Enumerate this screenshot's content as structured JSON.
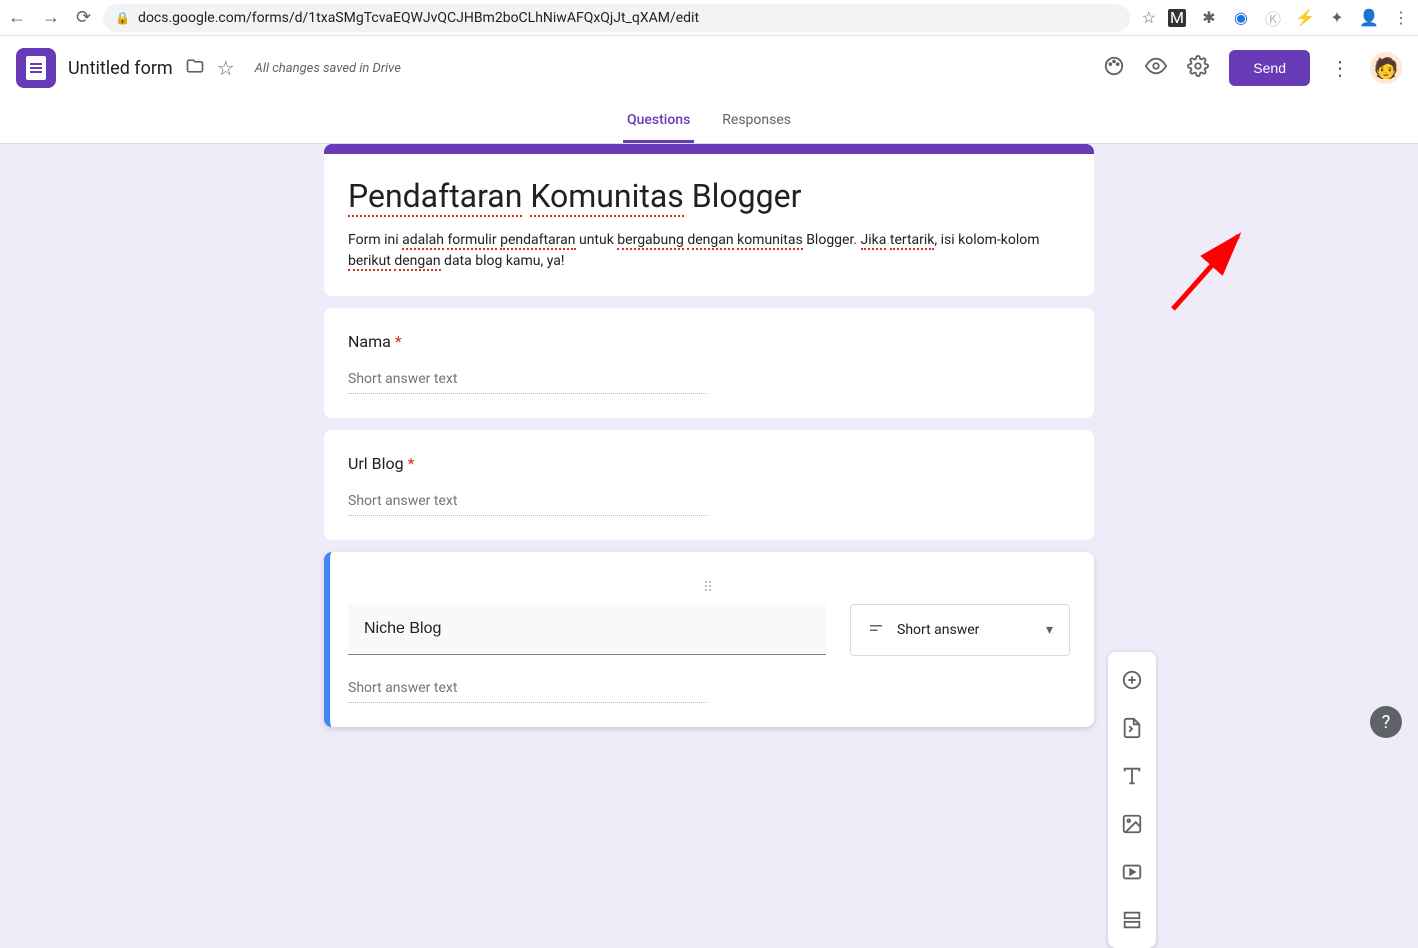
{
  "browser": {
    "url": "docs.google.com/forms/d/1txaSMgTcvaEQWJvQCJHBm2boCLhNiwAFQxQjJt_qXAM/edit"
  },
  "header": {
    "doc_title": "Untitled form",
    "save_status": "All changes saved in Drive",
    "send_label": "Send"
  },
  "tabs": {
    "questions": "Questions",
    "responses": "Responses"
  },
  "form": {
    "title_parts": {
      "p1": "Pendaftaran",
      "p2": "Komunitas",
      "p3": "Blogger"
    },
    "desc_parts": {
      "t1": "Form ini ",
      "s1": "adalah",
      "t2": " ",
      "s2": "formulir",
      "t3": " ",
      "s3": "pendaftaran",
      "t4": " untuk ",
      "s4": "bergabung",
      "t5": " ",
      "s5": "dengan",
      "t6": " ",
      "s6": "komunitas",
      "t7": " Blogger. ",
      "s7": "Jika",
      "t8": " ",
      "s8": "tertarik",
      "t9": ", isi kolom-kolom ",
      "s9": "berikut",
      "t10": " ",
      "s10": "dengan",
      "t11": " data blog kamu, ya!"
    }
  },
  "questions": {
    "q1": {
      "label": "Nama",
      "placeholder": "Short answer text"
    },
    "q2": {
      "label": "Url Blog",
      "placeholder": "Short answer text"
    },
    "q3": {
      "label": "Niche Blog",
      "type_label": "Short answer",
      "placeholder": "Short answer text"
    }
  }
}
